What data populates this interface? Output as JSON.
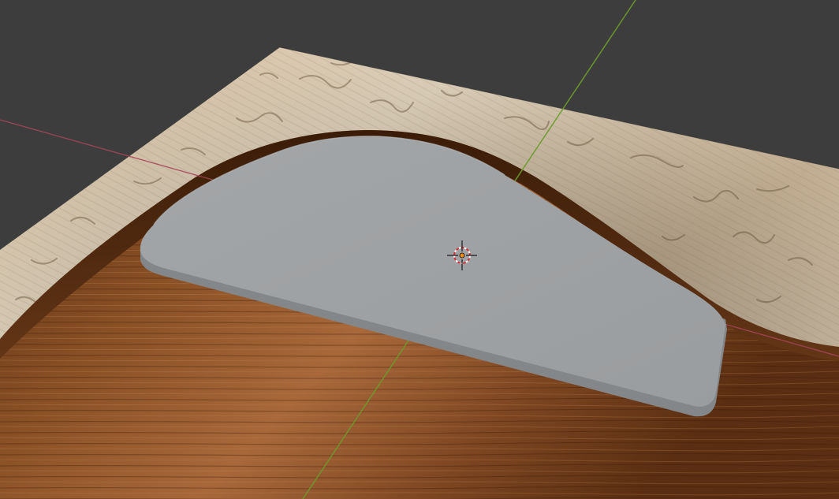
{
  "viewport": {
    "view": "3d-viewport-perspective",
    "background_color": "#3d3d3d",
    "x_axis_color": "#a8465a",
    "y_axis_color": "#6c9a2c"
  },
  "scene_objects": {
    "ground_plane": {
      "texture": "carved-wood",
      "light_surface_color": "#d8c4a6",
      "dark_surface_color": "#6a3a1a"
    },
    "selected_mesh": {
      "shape": "rounded-plate",
      "top_color": "#9fa2a4",
      "edge_color": "#848789"
    },
    "origin_marker": {
      "icon": "3d-cursor-icon"
    }
  }
}
